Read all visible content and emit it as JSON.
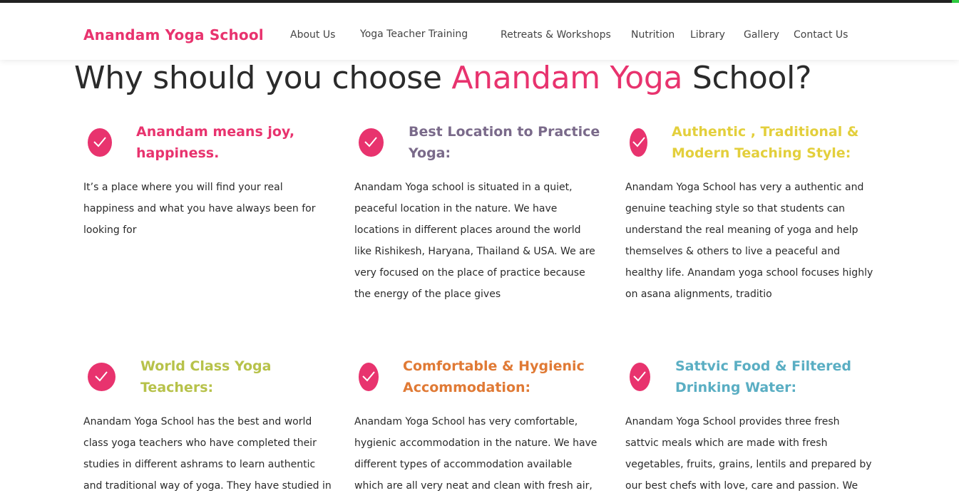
{
  "header": {
    "logo": "Anandam Yoga School",
    "nav": [
      "About Us",
      "Yoga Teacher Training",
      "Retreats & Workshops",
      "Nutrition",
      "Library",
      "Gallery",
      "Contact Us"
    ]
  },
  "headline": {
    "prefix": "Why should you choose ",
    "highlight": "Anandam Yoga",
    "suffix": " School?"
  },
  "colors": {
    "brand": "#e8336e",
    "purple": "#7a6a8a",
    "yellow": "#e3cf3c",
    "olive": "#b7c24a",
    "orange": "#e07a35",
    "teal": "#5aaec3"
  },
  "features": [
    {
      "title_line1": "Anandam means joy,",
      "title_line2": "happiness.",
      "color": "#e8336e",
      "icon": "check-circle-icon",
      "lines": [
        "It’s a place where you will find your real",
        "happiness and what you have always been for",
        "looking for"
      ]
    },
    {
      "title_line1": "Best Location to Practice",
      "title_line2": "Yoga:",
      "color": "#7a6a8a",
      "icon": "check-circle-icon",
      "lines": [
        "Anandam Yoga school is situated in a quiet,",
        "peaceful location in the nature. We have",
        "locations in different places around the world",
        "like Rishikesh, Haryana, Thailand & USA. We are",
        "very focused on the place of practice because",
        "the energy of the place gives"
      ]
    },
    {
      "title_line1": "Authentic , Traditional &",
      "title_line2": "Modern Teaching Style:",
      "color": "#e3cf3c",
      "icon": "check-circle-icon",
      "lines": [
        "Anandam Yoga School has very a authentic and",
        "genuine teaching style so that students can",
        "understand the real meaning of yoga and help",
        "themselves & others to live a peaceful and",
        "healthy life. Anandam yoga school focuses highly",
        "on asana alignments, traditio"
      ]
    },
    {
      "title_line1": "World Class Yoga",
      "title_line2": "Teachers:",
      "color": "#b7c24a",
      "icon": "check-circle-icon",
      "lines": [
        "Anandam Yoga School has the best and world",
        "class yoga teachers who have completed their",
        "studies in different ashrams to learn authentic",
        "and traditional way of yoga. They have studied in"
      ]
    },
    {
      "title_line1": "Comfortable & Hygienic",
      "title_line2": "Accommodation:",
      "color": "#e07a35",
      "icon": "check-circle-icon",
      "lines": [
        "Anandam Yoga School has very comfortable,",
        "hygienic accommodation in the nature. We have",
        "different types of accommodation available",
        "which are all very neat and clean with fresh air,"
      ]
    },
    {
      "title_line1": "Sattvic Food & Filtered",
      "title_line2": "Drinking Water:",
      "color": "#5aaec3",
      "icon": "check-circle-icon",
      "lines": [
        "Anandam Yoga School provides three fresh",
        "sattvic meals which are made with fresh",
        "vegetables, fruits, grains, lentils and prepared by",
        "our best chefs with love, care and passion. We"
      ]
    }
  ]
}
